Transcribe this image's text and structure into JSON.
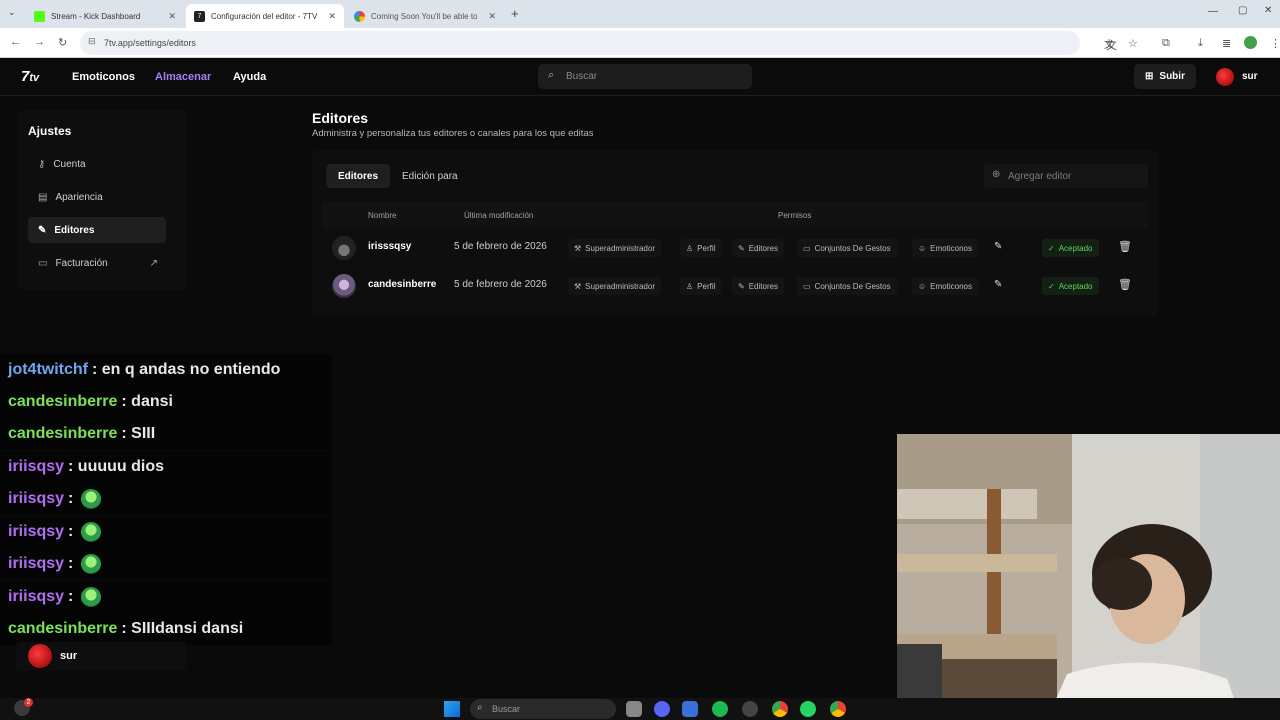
{
  "browser": {
    "tabs": [
      {
        "title": "Stream - Kick Dashboard",
        "active": false
      },
      {
        "title": "Configuración del editor - 7TV",
        "active": true
      },
      {
        "title": "Coming Soon You'll be able to",
        "active": false
      }
    ],
    "url": "7tv.app/settings/editors"
  },
  "header": {
    "nav": [
      "Emoticonos",
      "Almacenar",
      "Ayuda"
    ],
    "search_placeholder": "Buscar",
    "upload_label": "Subir",
    "username": "sur",
    "accent_color": "#a97cf8"
  },
  "sidebar": {
    "title": "Ajustes",
    "items": [
      {
        "label": "Cuenta",
        "icon": "key-icon"
      },
      {
        "label": "Apariencia",
        "icon": "paint-roller-icon"
      },
      {
        "label": "Editores",
        "icon": "pencil-icon"
      },
      {
        "label": "Facturación",
        "icon": "billing-icon"
      }
    ]
  },
  "main": {
    "title": "Editores",
    "subtitle": "Administra y personaliza tus editores o canales para los que editas",
    "tabs": [
      "Editores",
      "Edición para"
    ],
    "add_editor_placeholder": "Agregar editor",
    "columns": [
      "Nombre",
      "Última modificación",
      "Permisos"
    ],
    "rows": [
      {
        "name": "irisssqsy",
        "date": "5 de febrero de 2026",
        "permissions": [
          "Superadministrador",
          "Perfil",
          "Editores",
          "Conjuntos De Gestos",
          "Emoticonos"
        ],
        "status": "Aceptado"
      },
      {
        "name": "candesinberre",
        "date": "5 de febrero de 2026",
        "permissions": [
          "Superadministrador",
          "Perfil",
          "Editores",
          "Conjuntos De Gestos",
          "Emoticonos"
        ],
        "status": "Aceptado"
      }
    ]
  },
  "chat": {
    "messages": [
      {
        "user": "jot4twitchf",
        "color": "#6fa8f0",
        "text": ": en q andas no entiendo",
        "emote": false
      },
      {
        "user": "candesinberre",
        "color": "#7be05a",
        "text": ": dansi",
        "emote": false
      },
      {
        "user": "candesinberre",
        "color": "#7be05a",
        "text": ": SIII",
        "emote": false
      },
      {
        "user": "iriisqsy",
        "color": "#b06ef0",
        "text": ": uuuuu dios",
        "emote": false
      },
      {
        "user": "iriisqsy",
        "color": "#b06ef0",
        "text": ":",
        "emote": true
      },
      {
        "user": "iriisqsy",
        "color": "#b06ef0",
        "text": ":",
        "emote": true
      },
      {
        "user": "iriisqsy",
        "color": "#b06ef0",
        "text": ":",
        "emote": true
      },
      {
        "user": "iriisqsy",
        "color": "#b06ef0",
        "text": ":",
        "emote": true
      },
      {
        "user": "candesinberre",
        "color": "#7be05a",
        "text": ": SIIIdansi dansi",
        "emote": false
      }
    ],
    "footer_user": "sur"
  },
  "taskbar": {
    "search_placeholder": "Buscar",
    "notification_count": "2"
  }
}
